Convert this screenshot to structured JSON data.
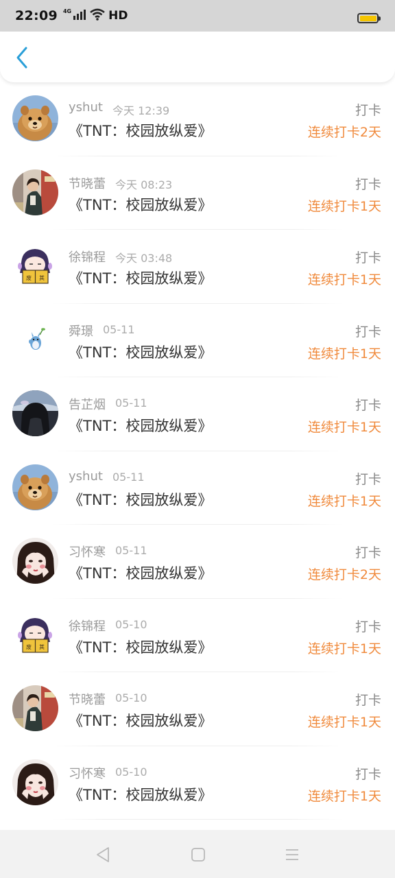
{
  "status_bar": {
    "time": "22:09",
    "network": "4G",
    "hd": "HD",
    "battery_level": 1.0
  },
  "header": {
    "back_icon": "chevron-left-icon",
    "accent_color": "#2a9fd8"
  },
  "colors": {
    "streak": "#f08a3c",
    "meta": "#9a9a9a",
    "title": "#333333"
  },
  "rows": [
    {
      "user": "yshut",
      "time": "今天 12:39",
      "title": "《TNT：校园放纵爱》",
      "action": "打卡",
      "streak": "连续打卡2天",
      "avatar": "dog-avatar"
    },
    {
      "user": "节晓蕾",
      "time": "今天 08:23",
      "title": "《TNT：校园放纵爱》",
      "action": "打卡",
      "streak": "连续打卡1天",
      "avatar": "girl-street-avatar"
    },
    {
      "user": "徐锦程",
      "time": "今天 03:48",
      "title": "《TNT：校园放纵爱》",
      "action": "打卡",
      "streak": "连续打卡1天",
      "avatar": "cartoon-book-avatar"
    },
    {
      "user": "舜璟",
      "time": "05-11",
      "title": "《TNT：校园放纵爱》",
      "action": "打卡",
      "streak": "连续打卡1天",
      "avatar": "totoro-avatar"
    },
    {
      "user": "告芷烟",
      "time": "05-11",
      "title": "《TNT：校园放纵爱》",
      "action": "打卡",
      "streak": "连续打卡1天",
      "avatar": "dark-hair-avatar"
    },
    {
      "user": "yshut",
      "time": "05-11",
      "title": "《TNT：校园放纵爱》",
      "action": "打卡",
      "streak": "连续打卡1天",
      "avatar": "dog-avatar"
    },
    {
      "user": "习怀寒",
      "time": "05-11",
      "title": "《TNT：校园放纵爱》",
      "action": "打卡",
      "streak": "连续打卡2天",
      "avatar": "girl-face-avatar"
    },
    {
      "user": "徐锦程",
      "time": "05-10",
      "title": "《TNT：校园放纵爱》",
      "action": "打卡",
      "streak": "连续打卡1天",
      "avatar": "cartoon-book-avatar"
    },
    {
      "user": "节晓蕾",
      "time": "05-10",
      "title": "《TNT：校园放纵爱》",
      "action": "打卡",
      "streak": "连续打卡1天",
      "avatar": "girl-street-avatar"
    },
    {
      "user": "习怀寒",
      "time": "05-10",
      "title": "《TNT：校园放纵爱》",
      "action": "打卡",
      "streak": "连续打卡1天",
      "avatar": "girl-face-avatar"
    }
  ],
  "nav": {
    "back_icon": "triangle-back-icon",
    "home_icon": "square-home-icon",
    "menu_icon": "menu-lines-icon"
  }
}
